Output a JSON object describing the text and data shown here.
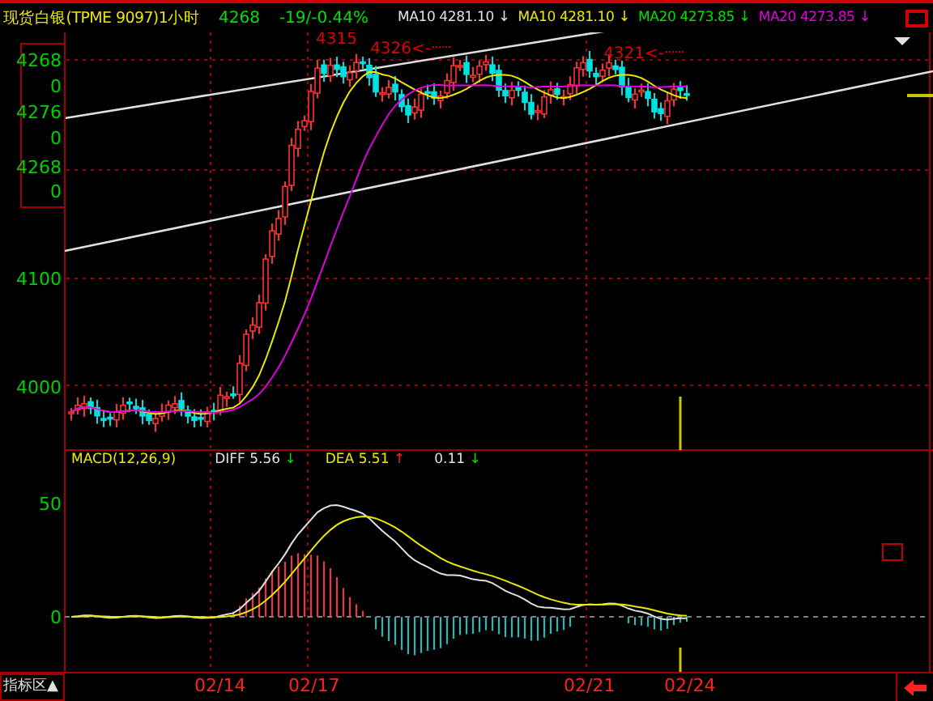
{
  "header": {
    "title": "现货白银(TPME 9097)1小时",
    "price": "4268",
    "change": "-19/-0.44%",
    "indicators": [
      {
        "label": "MA10 4281.10",
        "arrow": "↓",
        "color": "#e0e0e0"
      },
      {
        "label": "MA10 4281.10",
        "arrow": "↓",
        "color": "#e8e800"
      },
      {
        "label": "MA20 4273.85",
        "arrow": "↓",
        "color": "#00e000"
      },
      {
        "label": "MA20 4273.85",
        "arrow": "↓",
        "color": "#e000e0"
      }
    ]
  },
  "price_popup": [
    "4268",
    "0",
    "4276",
    "0",
    "4268",
    "0"
  ],
  "price_axis": [
    "4100",
    "4000"
  ],
  "peak_labels": [
    "4315",
    "4326<-",
    "4321<-"
  ],
  "macd": {
    "title": "MACD(12,26,9)",
    "values": [
      {
        "label": "DIFF",
        "value": "5.56",
        "arrow": "↓",
        "color": "#00e000"
      },
      {
        "label": "DEA",
        "value": "5.51",
        "arrow": "↑",
        "color": "#ff2020"
      },
      {
        "value": "0.11",
        "arrow": "↓",
        "color": "#00e000"
      }
    ],
    "axis": [
      "50",
      "0"
    ]
  },
  "footer": {
    "indicator_tab": "指标区▲",
    "dates": [
      "02/14",
      "02/17",
      "02/21",
      "02/24"
    ]
  }
}
